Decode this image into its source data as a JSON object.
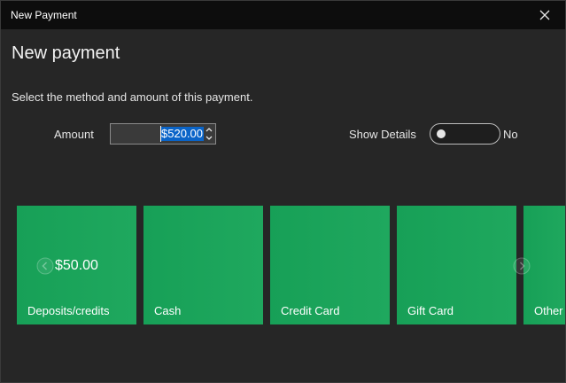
{
  "window": {
    "title": "New Payment"
  },
  "header": {
    "heading": "New payment",
    "description": "Select the method and amount of this payment."
  },
  "form": {
    "amount_label": "Amount",
    "amount_value": "$520.00",
    "show_details_label": "Show Details",
    "show_details_state": "No",
    "show_details_on": false
  },
  "tiles": [
    {
      "label": "Deposits/credits",
      "amount": "$50.00"
    },
    {
      "label": "Cash"
    },
    {
      "label": "Credit Card"
    },
    {
      "label": "Gift Card"
    },
    {
      "label": "Other"
    }
  ],
  "icons": {
    "close": "close-icon",
    "spin_up": "chevron-up-icon",
    "spin_down": "chevron-down-icon",
    "prev": "chevron-left-icon",
    "next": "chevron-right-icon"
  },
  "colors": {
    "tile": "#1aa35a",
    "background": "#262626",
    "titlebar": "#0d0d0d",
    "selection": "#0a64c8"
  }
}
